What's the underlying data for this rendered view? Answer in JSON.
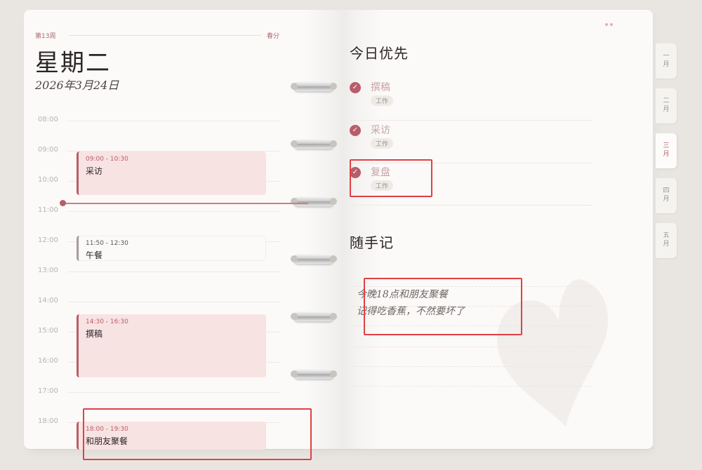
{
  "header": {
    "week_label": "第13周",
    "term_label": "春分",
    "weekday": "星期二",
    "date": "2026年3月24日"
  },
  "timeline": {
    "hours": [
      "08:00",
      "09:00",
      "10:00",
      "11:00",
      "12:00",
      "13:00",
      "14:00",
      "15:00",
      "16:00",
      "17:00",
      "18:00"
    ],
    "events": [
      {
        "time": "09:00 - 10:30",
        "name": "采访"
      },
      {
        "time": "11:50 - 12:30",
        "name": "午餐"
      },
      {
        "time": "14:30 - 16:30",
        "name": "撰稿"
      },
      {
        "time": "18:00 - 19:30",
        "name": "和朋友聚餐"
      }
    ]
  },
  "priorities": {
    "title": "今日优先",
    "items": [
      {
        "title": "撰稿",
        "tag": "工作"
      },
      {
        "title": "采访",
        "tag": "工作"
      },
      {
        "title": "复盘",
        "tag": "工作"
      }
    ]
  },
  "notes": {
    "title": "随手记",
    "lines": [
      "今晚18点和朋友聚餐",
      "记得吃香蕉，不然要坏了"
    ]
  },
  "months": [
    {
      "label": "一月",
      "active": false
    },
    {
      "label": "二月",
      "active": false
    },
    {
      "label": "三月",
      "active": true
    },
    {
      "label": "四月",
      "active": false
    },
    {
      "label": "五月",
      "active": false
    }
  ],
  "colors": {
    "accent": "#b85d6a",
    "highlight": "#e04046"
  }
}
